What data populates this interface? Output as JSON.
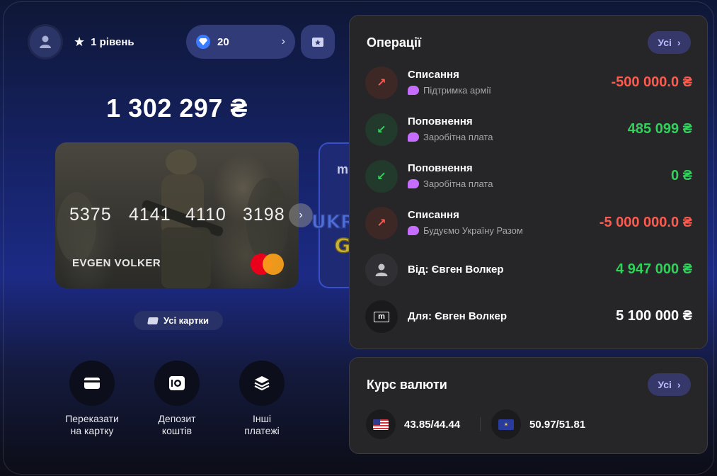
{
  "header": {
    "level_label": "1 рівень",
    "points_value": "20",
    "icons": {
      "avatar": "user-icon",
      "level": "star-icon",
      "points": "gem-icon",
      "gift": "gift-icon"
    }
  },
  "balance": {
    "amount": "1 302 297 ₴"
  },
  "card": {
    "number_groups": [
      "5375",
      "4141",
      "4110",
      "3198"
    ],
    "holder": "EVGEN VOLKER",
    "brand_icon": "mastercard-logo",
    "next_card_label": "m"
  },
  "all_cards_label": "Усі картки",
  "actions": [
    {
      "line1": "Переказати",
      "line2": "на картку",
      "icon": "card-icon"
    },
    {
      "line1": "Депозит",
      "line2": "коштів",
      "icon": "deposit-icon"
    },
    {
      "line1": "Інші",
      "line2": "платежі",
      "icon": "layers-icon"
    }
  ],
  "operations": {
    "title": "Операції",
    "all_label": "Усі",
    "items": [
      {
        "title": "Списання",
        "category": "Підтримка армії",
        "amount": "-500 000.0 ₴",
        "kind": "out",
        "icon": "arrow-up-right-icon"
      },
      {
        "title": "Поповнення",
        "category": "Заробітна плата",
        "amount": "485 099 ₴",
        "kind": "in",
        "icon": "arrow-down-left-icon"
      },
      {
        "title": "Поповнення",
        "category": "Заробітна плата",
        "amount": "0 ₴",
        "kind": "in",
        "icon": "arrow-down-left-icon"
      },
      {
        "title": "Списання",
        "category": "Будуємо Україну Разом",
        "amount": "-5 000 000.0 ₴",
        "kind": "out",
        "icon": "arrow-up-right-icon"
      },
      {
        "title": "Від: Євген Волкер",
        "category": "",
        "amount": "4 947 000 ₴",
        "kind": "person",
        "icon": "person-icon"
      },
      {
        "title": "Для: Євген Волкер",
        "category": "",
        "amount": "5 100 000 ₴",
        "kind": "m",
        "icon": "m-badge-icon"
      }
    ]
  },
  "currency": {
    "title": "Курс валюти",
    "all_label": "Усі",
    "usd": {
      "rate": "43.85/44.44",
      "icon": "us-flag-icon"
    },
    "eur": {
      "rate": "50.97/51.81",
      "icon": "eu-flag-icon"
    }
  },
  "watermark": {
    "line1": "UKRAINE",
    "line2": "GTA"
  },
  "colors": {
    "negative": "#ff5a4e",
    "positive": "#2fd35a",
    "accent": "#b9bcff"
  }
}
